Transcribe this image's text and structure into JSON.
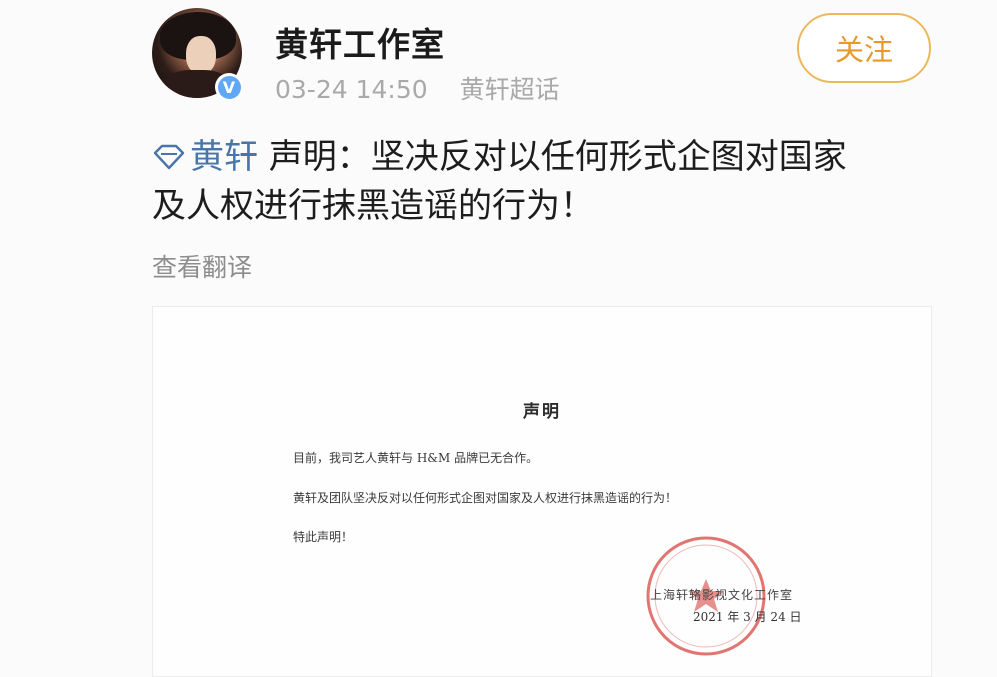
{
  "post": {
    "author": "黄轩工作室",
    "timestamp": "03-24 14:50",
    "source": "黄轩超话",
    "follow_label": "关注",
    "topic": "黄轩",
    "text_line1": " 声明：坚决反对以任何形式企图对国家",
    "text_line2": "及人权进行抹黑造谣的行为！",
    "translate_label": "查看翻译",
    "verified_mark": "V"
  },
  "document": {
    "title": "声明",
    "paragraph1": "目前，我司艺人黄轩与 H&M 品牌已无合作。",
    "paragraph2": "黄轩及团队坚决反对以任何形式企图对国家及人权进行抹黑造谣的行为！",
    "paragraph3": "特此声明！",
    "signature": "上海轩辂影视文化工作室",
    "date": "2021 年 3 月 24 日",
    "seal_color": "#d9534f"
  },
  "colors": {
    "topic_link": "#4a75a8",
    "follow_accent": "#e79a2c",
    "verified": "#5fa8f5"
  }
}
